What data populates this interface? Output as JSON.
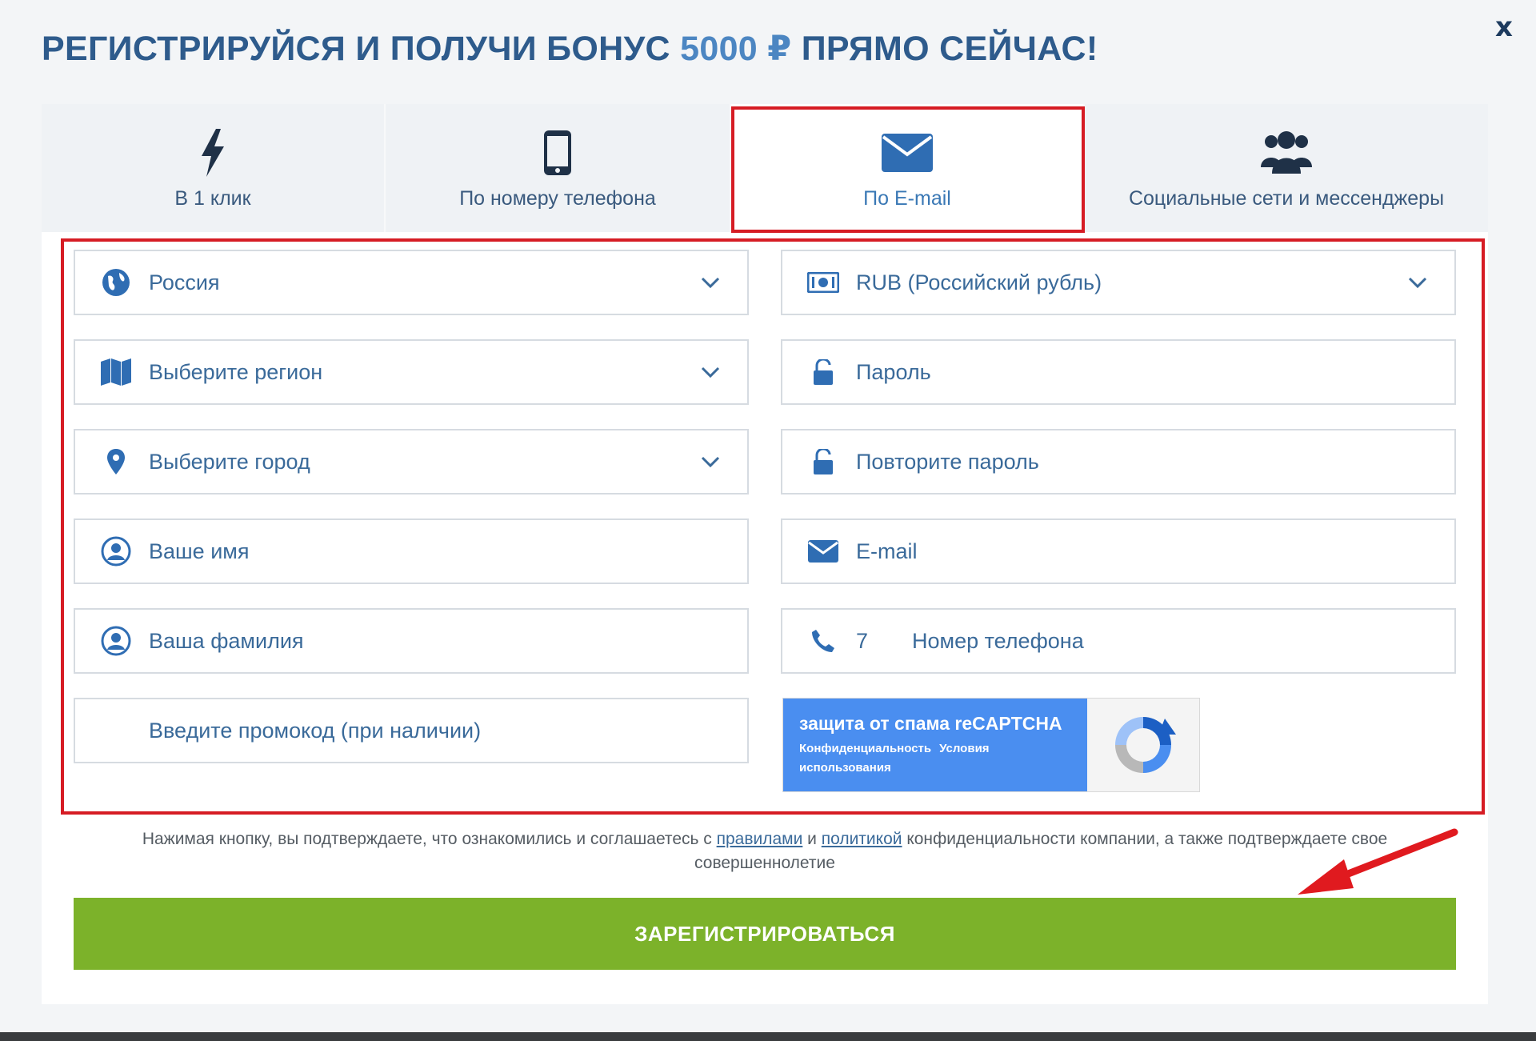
{
  "dialog": {
    "title_part1": "РЕГИСТРИРУЙСЯ И ПОЛУЧИ БОНУС ",
    "title_accent": "5000 ₽",
    "title_part2": " ПРЯМО СЕЙЧАС!",
    "close_label": "x"
  },
  "tabs": [
    {
      "label": "В 1 клик",
      "icon": "lightning-icon",
      "active": false
    },
    {
      "label": "По номеру телефона",
      "icon": "smartphone-icon",
      "active": false
    },
    {
      "label": "По E-mail",
      "icon": "envelope-icon",
      "active": true
    },
    {
      "label": "Социальные сети и мессенджеры",
      "icon": "users-group-icon",
      "active": false
    }
  ],
  "form": {
    "country": {
      "value": "Россия",
      "icon": "globe-icon"
    },
    "region": {
      "placeholder": "Выберите регион",
      "icon": "map-icon"
    },
    "city": {
      "placeholder": "Выберите город",
      "icon": "location-pin-icon"
    },
    "first_name": {
      "placeholder": "Ваше имя",
      "icon": "user-circle-icon"
    },
    "last_name": {
      "placeholder": "Ваша фамилия",
      "icon": "user-circle-icon"
    },
    "promo": {
      "placeholder": "Введите промокод (при наличии)"
    },
    "currency": {
      "value": "RUB (Российский рубль)",
      "icon": "banknote-icon"
    },
    "password": {
      "placeholder": "Пароль",
      "icon": "lock-icon"
    },
    "password_repeat": {
      "placeholder": "Повторите пароль",
      "icon": "lock-icon"
    },
    "email": {
      "placeholder": "E-mail",
      "icon": "envelope-icon"
    },
    "phone": {
      "prefix": "7",
      "placeholder": "Номер телефона",
      "icon": "phone-icon"
    }
  },
  "captcha": {
    "title": "защита от спама reCAPTCHA",
    "privacy": "Конфиденциальность",
    "terms": "Условия использования"
  },
  "disclaimer": {
    "part1": "Нажимая кнопку, вы подтверждаете, что ознакомились и соглашаетесь с ",
    "rules_link": "правилами",
    "part2": " и ",
    "policy_link": "политикой",
    "part3": " конфиденциальности компании, а также подтверждаете свое совершеннолетие"
  },
  "submit_label": "ЗАРЕГИСТРИРОВАТЬСЯ",
  "colors": {
    "accent_blue": "#2e5b8c",
    "highlight_red": "#d61c24",
    "submit_green": "#7cb22a",
    "captcha_blue": "#4a8ef0"
  }
}
